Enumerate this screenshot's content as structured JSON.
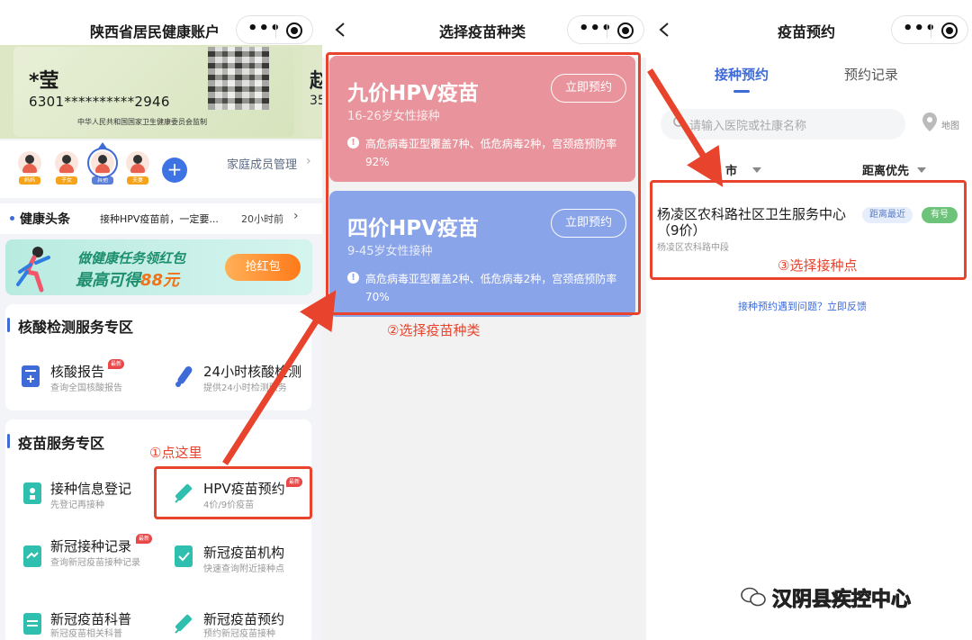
{
  "panel1": {
    "title": "陕西省居民健康账户",
    "id_card": {
      "name": "*莹",
      "number": "6301**********2946",
      "certification": "中华人民共和国国家卫生健康委员会监制",
      "second_card_name": "赵",
      "second_card_number": "35"
    },
    "family": {
      "members": [
        {
          "tag": "妈妈"
        },
        {
          "tag": "子女"
        },
        {
          "tag": "其他"
        },
        {
          "tag": "夫妻"
        }
      ],
      "manage_label": "家庭成员管理"
    },
    "news": {
      "title": "健康头条",
      "text": "接种HPV疫苗前，一定要...",
      "time": "20小时前"
    },
    "banner": {
      "line1": "做健康任务领红包",
      "line2_prefix": "最高可得",
      "line2_amount": "88元",
      "button": "抢红包"
    },
    "nucleic_section": {
      "title": "核酸检测服务专区",
      "items": [
        {
          "label": "核酸报告",
          "badge": "最新",
          "sub": "查询全国核酸报告"
        },
        {
          "label": "24小时核酸检测",
          "sub": "提供24小时检测服务"
        }
      ]
    },
    "vaccine_section": {
      "title": "疫苗服务专区",
      "items": [
        {
          "label": "接种信息登记",
          "sub": "先登记再接种"
        },
        {
          "label": "HPV疫苗预约",
          "badge": "最新",
          "sub": "4价/9价疫苗"
        },
        {
          "label": "新冠接种记录",
          "badge": "最新",
          "sub": "查询新冠疫苗接种记录"
        },
        {
          "label": "新冠疫苗机构",
          "sub": "快速查询附近接种点"
        },
        {
          "label": "新冠疫苗科普",
          "sub": "新冠疫苗相关科普"
        },
        {
          "label": "新冠疫苗预约",
          "sub": "预约新冠疫苗接种"
        }
      ]
    },
    "annotation": "①点这里"
  },
  "panel2": {
    "title": "选择疫苗种类",
    "vaccines": [
      {
        "name": "九价HPV疫苗",
        "range": "16-26岁女性接种",
        "button": "立即预约",
        "desc": "高危病毒亚型覆盖7种、低危病毒2种，宫颈癌预防率92%"
      },
      {
        "name": "四价HPV疫苗",
        "range": "9-45岁女性接种",
        "button": "立即预约",
        "desc": "高危病毒亚型覆盖2种、低危病毒2种，宫颈癌预防率70%"
      }
    ],
    "annotation": "②选择疫苗种类"
  },
  "panel3": {
    "title": "疫苗预约",
    "tabs": [
      "接种预约",
      "预约记录"
    ],
    "search_placeholder": "请输入医院或社康名称",
    "map_label": "地图",
    "filters": {
      "city": "市",
      "sort": "距离优先"
    },
    "site": {
      "name": "杨凌区农科路社区卫生服务中心（9价）",
      "address": "杨凌区农科路中段",
      "badge_nearest": "距离最近",
      "badge_available": "有号"
    },
    "annotation": "③选择接种点",
    "feedback": "接种预约遇到问题？立即反馈"
  },
  "watermark": "汉阴县疾控中心",
  "colors": {
    "accent_blue": "#3e6bd8",
    "callout_red": "#e8432c",
    "hpv9_card": "#e9949c",
    "hpv4_card": "#8aa4ea",
    "available_green": "#6ec37b"
  }
}
